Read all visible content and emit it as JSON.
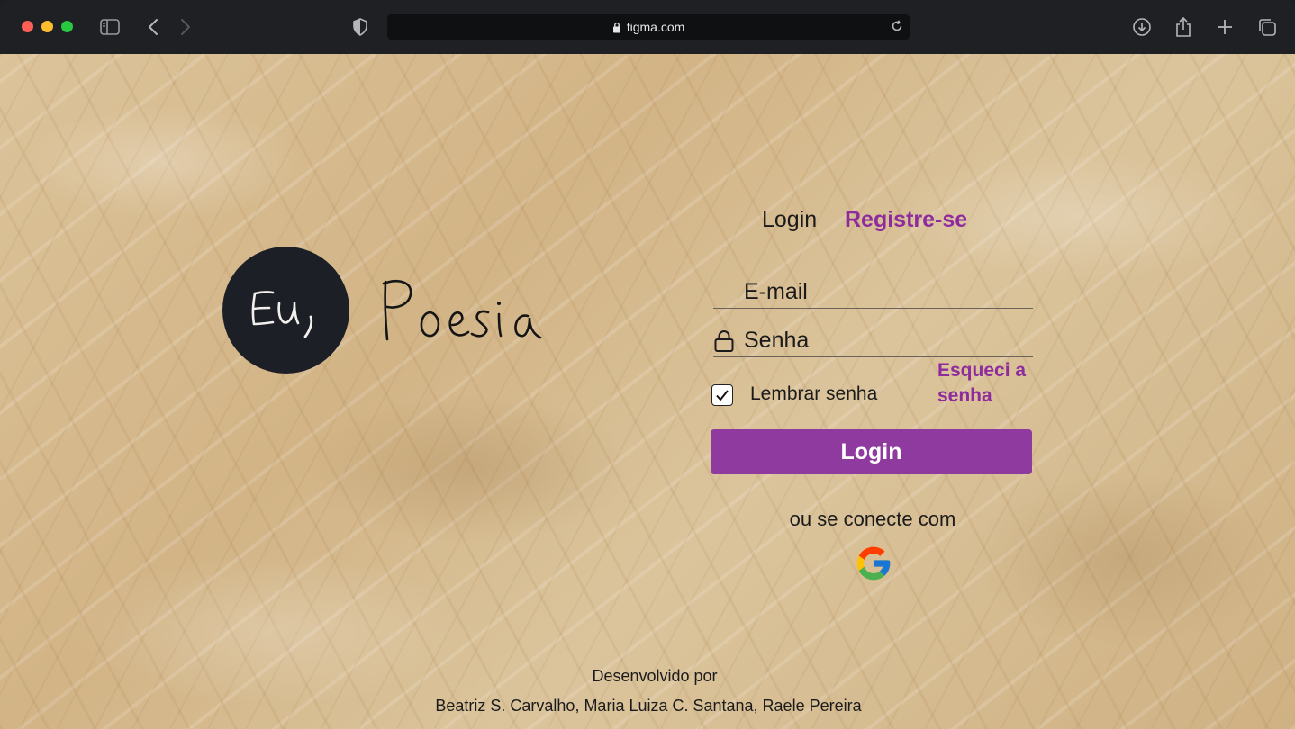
{
  "browser": {
    "url": "figma.com"
  },
  "logo": {
    "circle_text": "Eu,",
    "wordmark": "Poesia"
  },
  "tabs": {
    "login": "Login",
    "register": "Registre-se"
  },
  "form": {
    "email_placeholder": "E-mail",
    "password_placeholder": "Senha",
    "remember_label": "Lembrar senha",
    "remember_checked": true,
    "forgot_link": "Esqueci a senha",
    "login_button": "Login",
    "alt_connect": "ou se conecte com"
  },
  "footer": {
    "credit_label": "Desenvolvido por",
    "authors": "Beatriz S. Carvalho, Maria Luiza C. Santana, Raele Pereira"
  },
  "colors": {
    "accent": "#8e2c9e",
    "button": "#8e3a9f",
    "logo_circle": "#1d1f26"
  }
}
